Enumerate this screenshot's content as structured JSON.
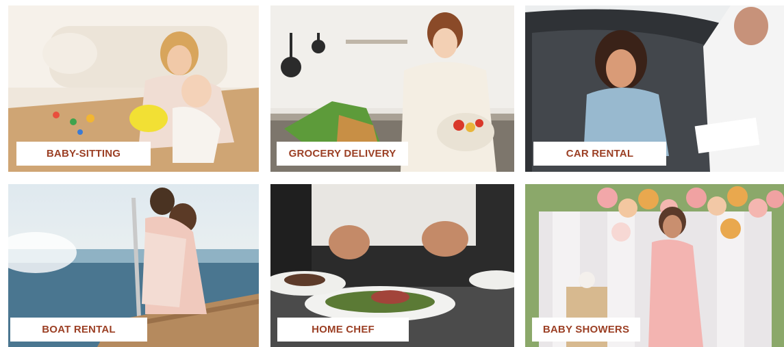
{
  "services": [
    {
      "label": "BABY-SITTING"
    },
    {
      "label": "GROCERY DELIVERY"
    },
    {
      "label": "CAR RENTAL"
    },
    {
      "label": "BOAT RENTAL"
    },
    {
      "label": "HOME CHEF"
    },
    {
      "label": "BABY SHOWERS"
    }
  ],
  "colors": {
    "label_text": "#9b3f24",
    "label_bg": "#ffffff"
  }
}
